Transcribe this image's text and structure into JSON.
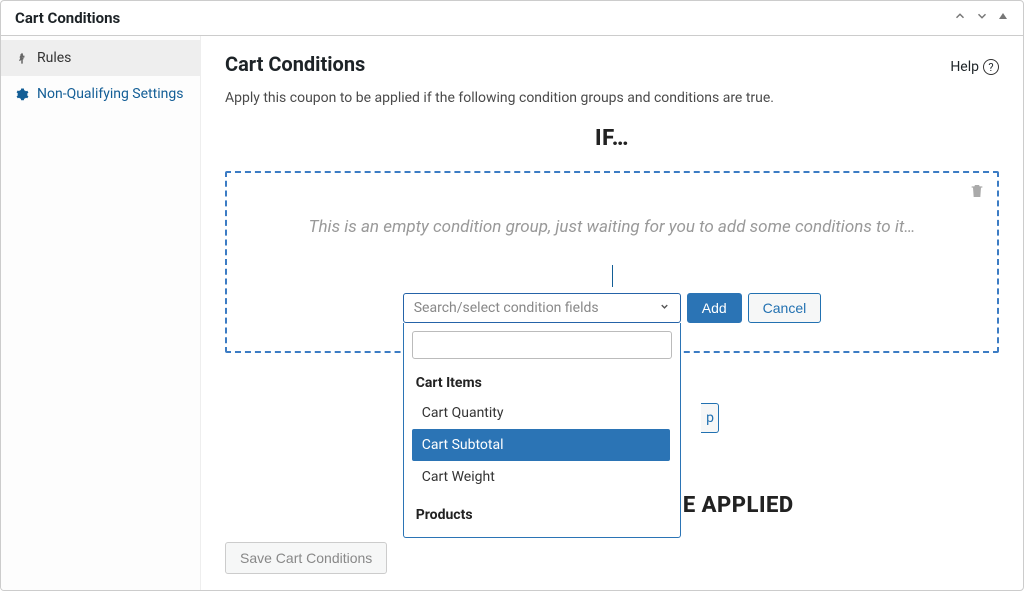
{
  "panel": {
    "title": "Cart Conditions"
  },
  "sidebar": {
    "items": [
      {
        "label": "Rules"
      },
      {
        "label": "Non-Qualifying Settings"
      }
    ]
  },
  "content": {
    "heading": "Cart Conditions",
    "help": "Help",
    "description": "Apply this coupon to be applied if the following condition groups and conditions are true.",
    "if_heading": "IF…",
    "group_placeholder": "This is an empty condition group, just waiting for you to add some conditions to it…",
    "select_placeholder": "Search/select condition fields",
    "add_button": "Add",
    "cancel_button": "Cancel",
    "applied_heading_fragment": "E APPLIED",
    "peek_button_fragment": "p",
    "save_button": "Save Cart Conditions"
  },
  "dropdown": {
    "search_value": "",
    "groups": [
      {
        "label": "Cart Items",
        "options": [
          {
            "label": "Cart Quantity",
            "selected": false
          },
          {
            "label": "Cart Subtotal",
            "selected": true
          },
          {
            "label": "Cart Weight",
            "selected": false
          }
        ]
      },
      {
        "label": "Products",
        "options": []
      }
    ]
  }
}
